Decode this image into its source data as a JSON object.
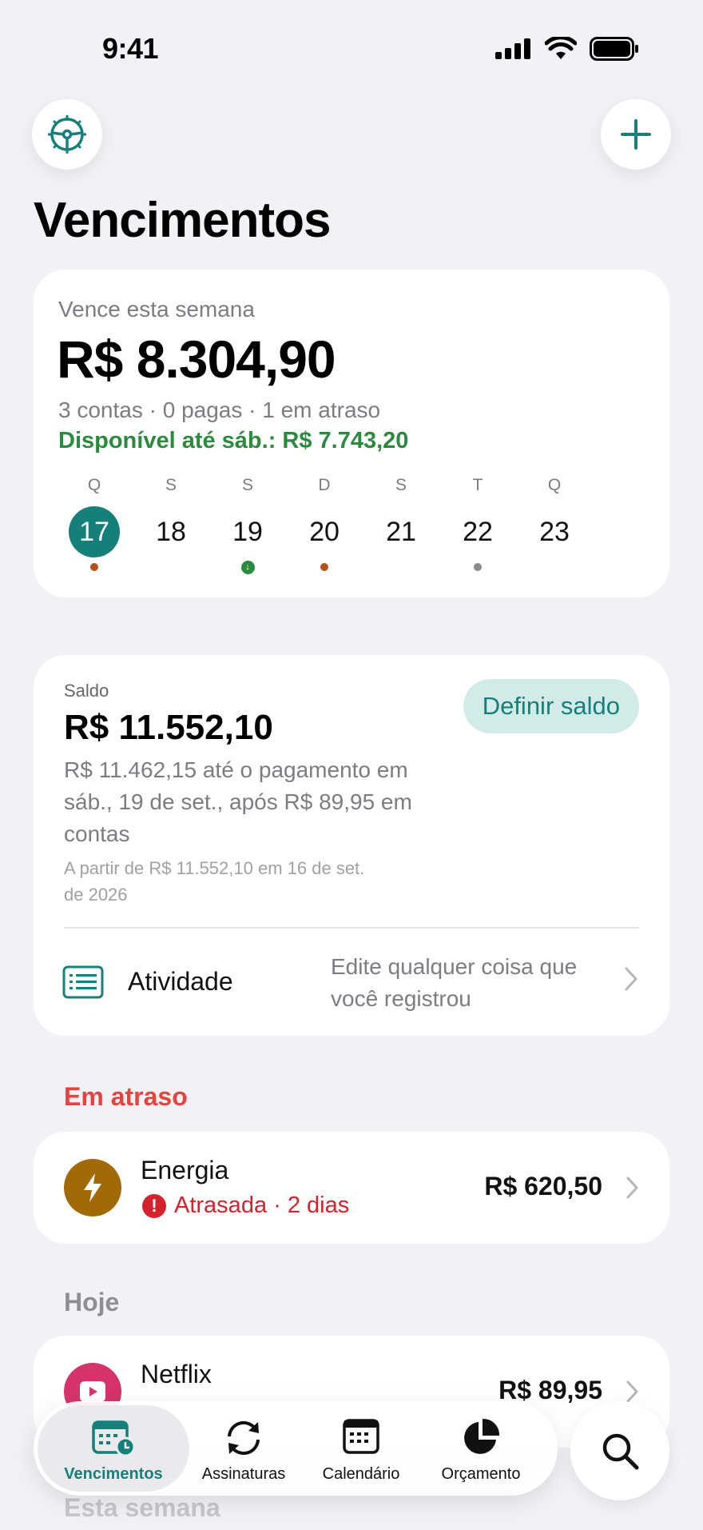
{
  "status_bar": {
    "time": "9:41"
  },
  "header": {
    "title": "Vencimentos"
  },
  "week": {
    "label": "Vence esta semana",
    "amount": "R$ 8.304,90",
    "meta": "3 contas · 0 pagas · 1 em atraso",
    "available": "Disponível até sáb.: R$ 7.743,20",
    "days": [
      {
        "letter": "Q",
        "number": "17",
        "selected": true,
        "marker": "orange"
      },
      {
        "letter": "S",
        "number": "18",
        "marker": "none"
      },
      {
        "letter": "S",
        "number": "19",
        "marker": "green-arrow"
      },
      {
        "letter": "D",
        "number": "20",
        "marker": "orange"
      },
      {
        "letter": "S",
        "number": "21",
        "marker": "none"
      },
      {
        "letter": "T",
        "number": "22",
        "marker": "gray"
      },
      {
        "letter": "Q",
        "number": "23",
        "marker": "none"
      }
    ]
  },
  "balance": {
    "label": "Saldo",
    "amount": "R$ 11.552,10",
    "description": "R$ 11.462,15 até o pagamento em sáb., 19 de set., após R$ 89,95 em contas",
    "note": "A partir de R$ 11.552,10 em 16 de set. de 2026",
    "define_button": "Definir saldo",
    "activity_label": "Atividade",
    "activity_hint": "Edite qualquer coisa que você registrou"
  },
  "sections": {
    "overdue": "Em atraso",
    "today": "Hoje",
    "this_week": "Esta semana"
  },
  "bills": {
    "energy": {
      "name": "Energia",
      "status": "Atrasada · 2 dias",
      "amount": "R$ 620,50",
      "icon": "lightning-icon"
    },
    "netflix": {
      "name": "Netflix",
      "amount": "R$ 89,95",
      "icon": "play-icon"
    }
  },
  "tabbar": {
    "tabs": [
      {
        "label": "Vencimentos",
        "icon": "calendar-clock-icon",
        "active": true
      },
      {
        "label": "Assinaturas",
        "icon": "refresh-icon"
      },
      {
        "label": "Calendário",
        "icon": "calendar-icon"
      },
      {
        "label": "Orçamento",
        "icon": "pie-chart-icon"
      }
    ]
  },
  "colors": {
    "accent": "#157f7a",
    "positive": "#2b8a3e",
    "danger": "#d3222b",
    "overdue_heading": "#e5433f",
    "energy_icon_bg": "#a16a06",
    "netflix_icon_bg": "#d6336c"
  }
}
